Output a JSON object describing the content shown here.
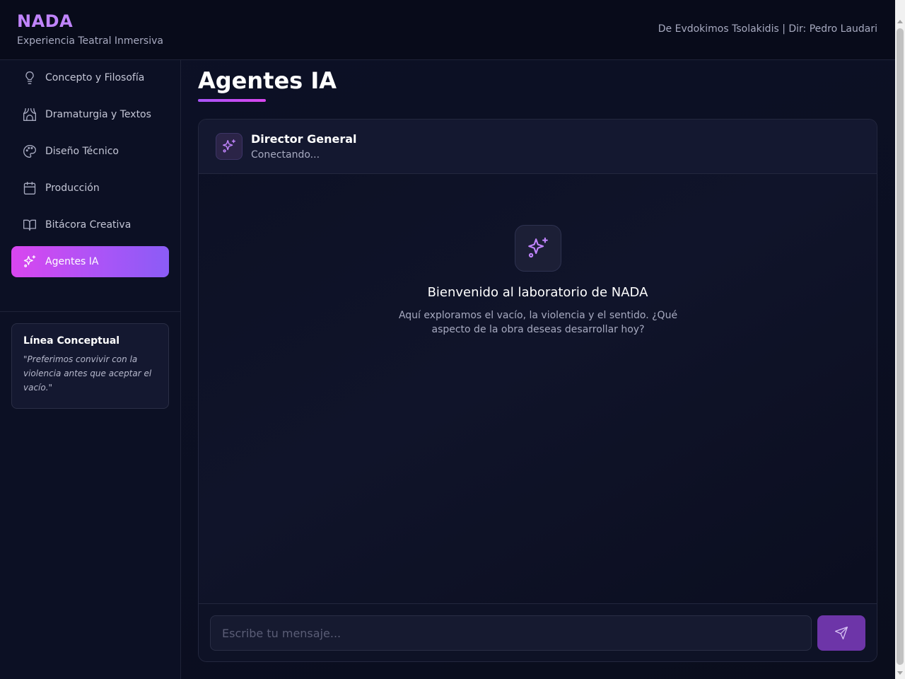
{
  "header": {
    "title": "NADA",
    "subtitle": "Experiencia Teatral Inmersiva",
    "credits": "De Evdokimos Tsolakidis | Dir: Pedro Laudari"
  },
  "sidebar": {
    "items": [
      {
        "label": "Concepto y Filosofía",
        "icon": "lightbulb-icon",
        "active": false
      },
      {
        "label": "Dramaturgia y Textos",
        "icon": "theater-icon",
        "active": false
      },
      {
        "label": "Diseño Técnico",
        "icon": "palette-icon",
        "active": false
      },
      {
        "label": "Producción",
        "icon": "calendar-icon",
        "active": false
      },
      {
        "label": "Bitácora Creativa",
        "icon": "book-icon",
        "active": false
      },
      {
        "label": "Agentes IA",
        "icon": "sparkles-icon",
        "active": true
      }
    ],
    "concept": {
      "title": "Línea Conceptual",
      "quote": "\"Preferimos convivir con la violencia antes que aceptar el vacío.\""
    }
  },
  "main": {
    "title": "Agentes IA",
    "agent": {
      "name": "Director General",
      "status": "Conectando..."
    },
    "welcome": {
      "title": "Bienvenido al laboratorio de NADA",
      "text": "Aquí exploramos el vacío, la violencia y el sentido. ¿Qué aspecto de la obra deseas desarrollar hoy?"
    },
    "input": {
      "placeholder": "Escribe tu mensaje...",
      "value": ""
    }
  },
  "colors": {
    "accent": "#a855f7",
    "accent_pink": "#d946ef",
    "brand": "#c084fc",
    "background": "#0b0f22"
  }
}
